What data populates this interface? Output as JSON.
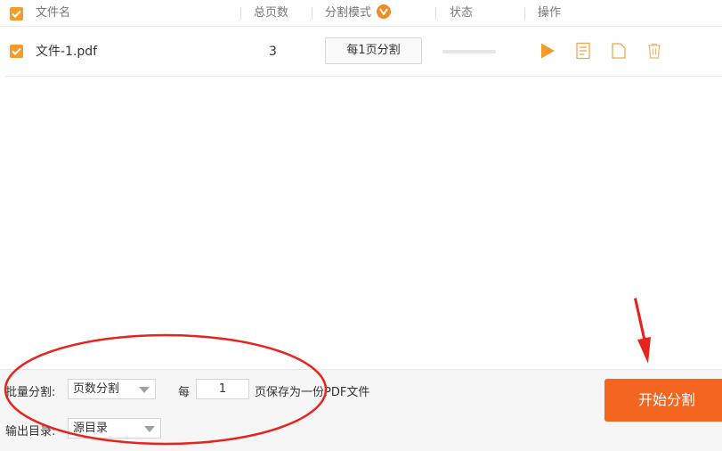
{
  "header": {
    "filename": "文件名",
    "pages": "总页数",
    "mode": "分割模式",
    "status": "状态",
    "actions": "操作"
  },
  "rows": [
    {
      "name": "文件-1.pdf",
      "pages": "3",
      "mode": "每1页分割"
    }
  ],
  "bottom": {
    "batch_label": "批量分割:",
    "batch_value": "页数分割",
    "every_label": "每",
    "every_value": "1",
    "suffix_label": "页保存为一份PDF文件",
    "output_label": "输出目录:",
    "output_value": "源目录"
  },
  "start_button": "开始分割",
  "colors": {
    "accent": "#f39c2c",
    "start": "#f4651f",
    "annotation": "#e8231d"
  },
  "icons": [
    "check-icon",
    "v-badge-icon",
    "play-icon",
    "document-icon",
    "folder-icon",
    "trash-icon",
    "dropdown-arrow-icon"
  ]
}
